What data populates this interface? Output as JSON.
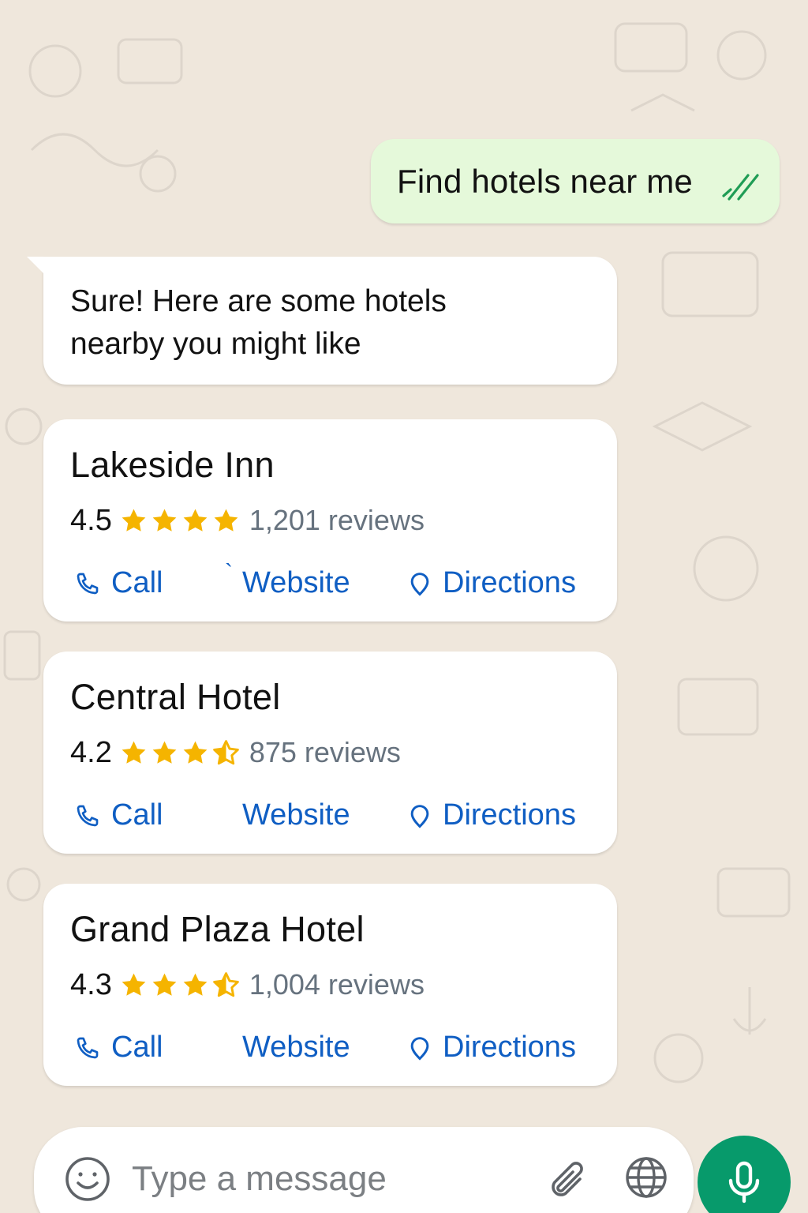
{
  "chat": {
    "outgoing": {
      "text": "Find hotels near me",
      "status_icon": "double-check-icon",
      "status_color": "#1f9d55"
    },
    "incoming": {
      "text": "Sure! Here are some hotels\nnearby you might like"
    },
    "hotels": [
      {
        "name": "Lakeside Inn",
        "rating": "4.5",
        "rating_value": 4.5,
        "reviews": "1,201 reviews",
        "stars": [
          "full",
          "full",
          "full",
          "full"
        ],
        "actions": {
          "call": "Call",
          "website": "Website",
          "directions": "Directions"
        },
        "stray_mark": "`"
      },
      {
        "name": "Central Hotel",
        "rating": "4.2",
        "rating_value": 4.2,
        "reviews": "875 reviews",
        "stars": [
          "full",
          "full",
          "full",
          "half"
        ],
        "actions": {
          "call": "Call",
          "website": "Website",
          "directions": "Directions"
        }
      },
      {
        "name": "Grand Plaza Hotel",
        "rating": "4.3",
        "rating_value": 4.3,
        "reviews": "1,004 reviews",
        "stars": [
          "full",
          "full",
          "full",
          "half"
        ],
        "actions": {
          "call": "Call",
          "website": "Website",
          "directions": "Directions"
        }
      }
    ]
  },
  "composer": {
    "placeholder": "Type a message",
    "emoji_icon": "emoji-icon",
    "attach_icon": "paperclip-icon",
    "globe_icon": "globe-icon",
    "mic_icon": "microphone-icon",
    "mic_color": "#079a6b"
  },
  "colors": {
    "background": "#efe7dc",
    "outgoing_bubble": "#e5f9da",
    "link": "#0f5ec3",
    "star": "#f5b400",
    "secondary_text": "#66727e"
  }
}
